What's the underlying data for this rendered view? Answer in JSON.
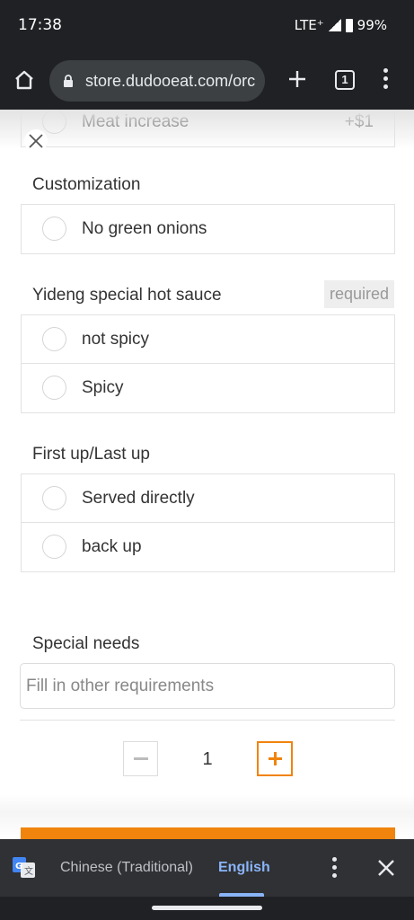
{
  "status_bar": {
    "time": "17:38",
    "network": "LTE⁺",
    "battery": "99%"
  },
  "browser": {
    "url": "store.dudooeat.com/orc",
    "tab_count": "1"
  },
  "partial_option": {
    "label": "Meat increase",
    "price": "+$1"
  },
  "sections": {
    "customization": {
      "title": "Customization",
      "options": [
        "No green onions"
      ]
    },
    "hot_sauce": {
      "title": "Yideng special hot sauce",
      "badge": "required",
      "options": [
        "not spicy",
        "Spicy"
      ]
    },
    "serving": {
      "title": "First up/Last up",
      "options": [
        "Served directly",
        "back up"
      ]
    },
    "special_needs": {
      "title": "Special needs",
      "placeholder": "Fill in other requirements"
    }
  },
  "quantity": {
    "value": "1"
  },
  "translate_bar": {
    "source_lang": "Chinese (Traditional)",
    "target_lang": "English"
  },
  "colors": {
    "accent": "#f0840d",
    "chrome_bg": "#202124",
    "translate_bg": "#303134",
    "link_blue": "#8ab4f8"
  },
  "icons": [
    "home-icon",
    "lock-icon",
    "plus-icon",
    "tab-switcher-icon",
    "overflow-menu-icon",
    "close-icon",
    "google-translate-icon"
  ]
}
